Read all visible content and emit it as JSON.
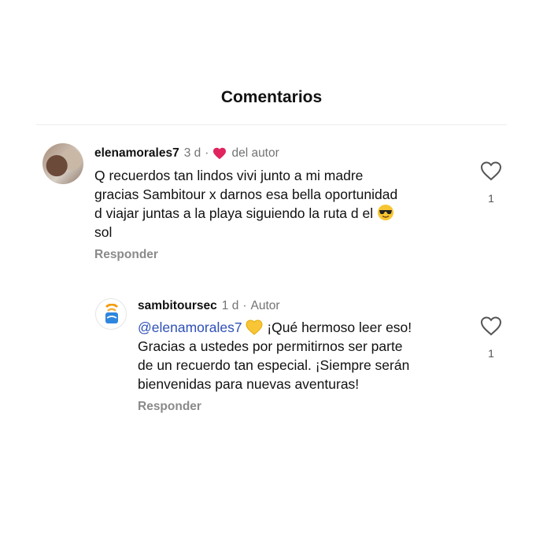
{
  "header": {
    "title": "Comentarios"
  },
  "comments": [
    {
      "username": "elenamorales7",
      "time": "3 d",
      "badge": "del autor",
      "lines": [
        "Q recuerdos tan lindos vivi junto a mi madre",
        "gracias Sambitour x darnos esa bella oportunidad",
        "d viajar juntas a la playa siguiendo la ruta d el",
        "sol"
      ],
      "emoji": "smiling-face-with-sunglasses",
      "reply_label": "Responder",
      "likes": "1"
    },
    {
      "username": "sambitoursec",
      "time": "1 d",
      "separator": "·",
      "badge": "Autor",
      "mention": "@elenamorales7",
      "emoji": "yellow-heart",
      "lines": [
        "¡Qué hermoso leer eso!",
        "Gracias a ustedes por permitirnos ser parte",
        "de un recuerdo tan especial. ¡Siempre serán",
        "bienvenidas para nuevas aventuras!"
      ],
      "reply_label": "Responder",
      "likes": "1"
    }
  ],
  "colors": {
    "author_heart": "#e0245e",
    "mention": "#2e4fb7",
    "muted": "#737373"
  }
}
